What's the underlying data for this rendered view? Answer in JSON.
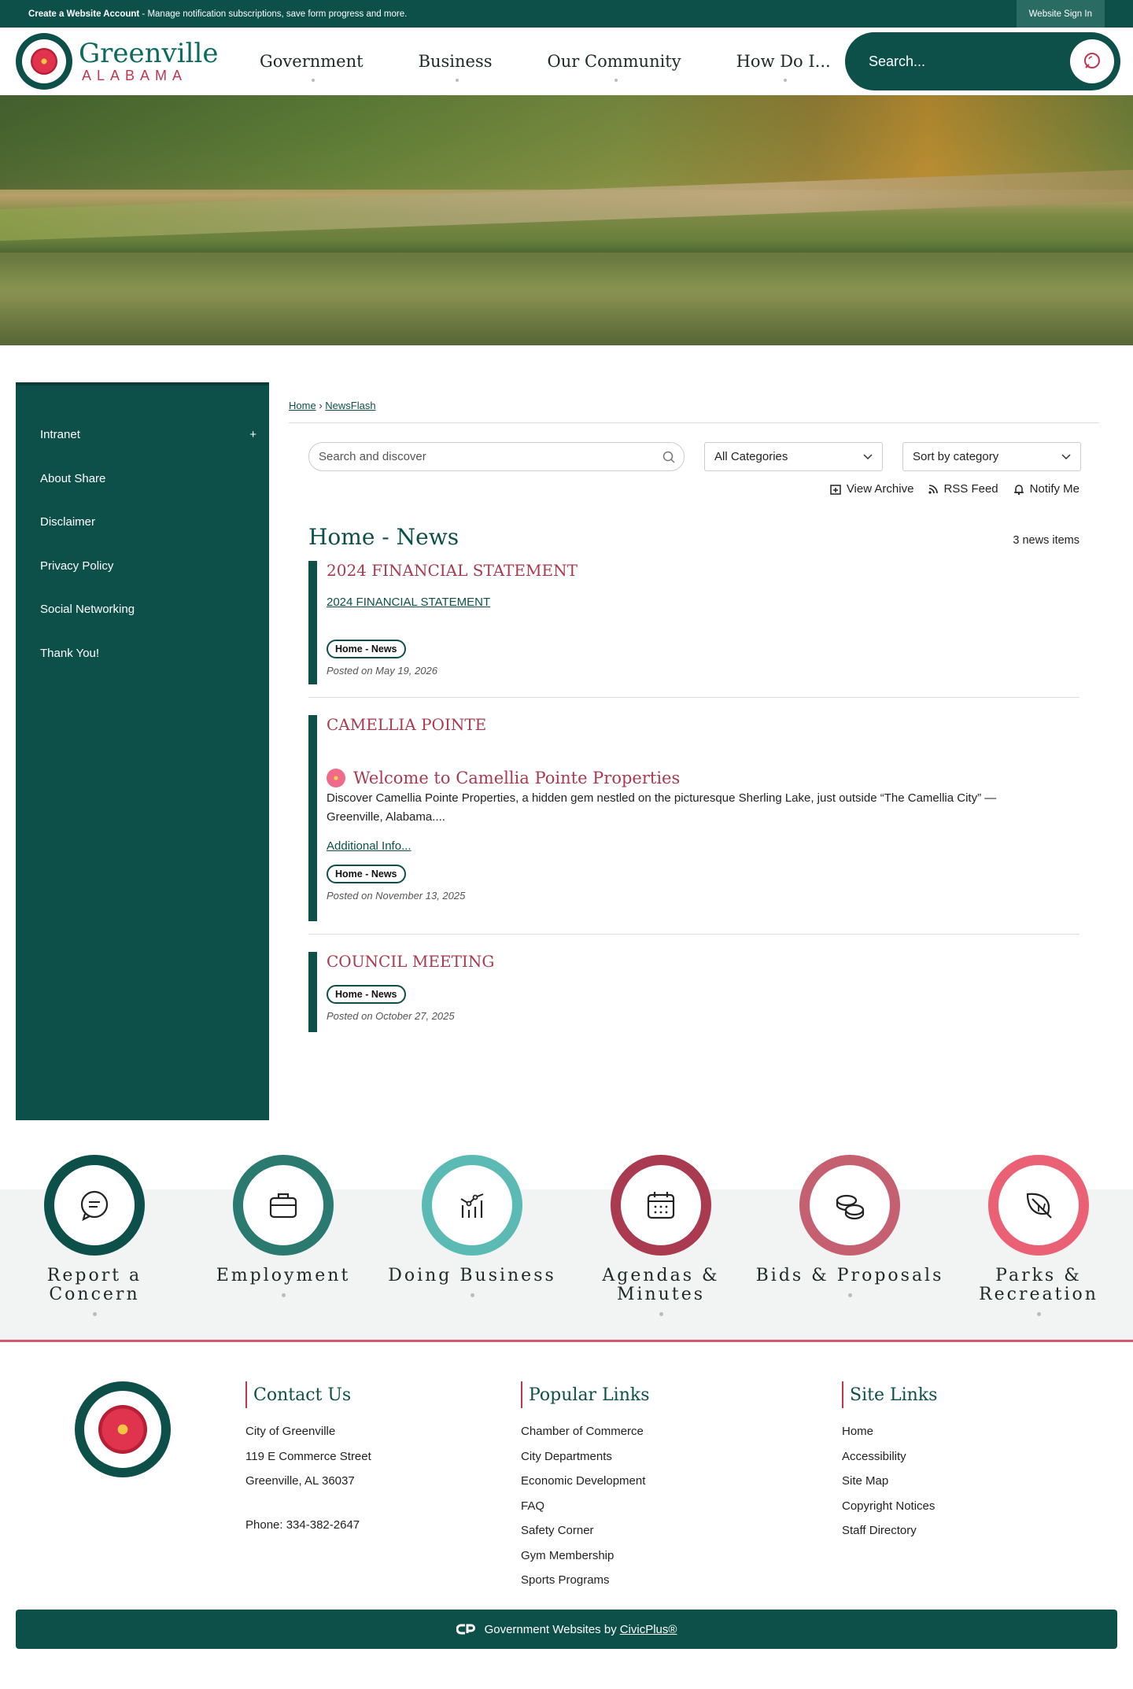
{
  "topbar": {
    "create_account": "Create a Website Account",
    "create_desc": " - Manage notification subscriptions, save form progress and more.",
    "sign_in": "Website Sign In"
  },
  "logo": {
    "name": "Greenville",
    "state": "ALABAMA"
  },
  "nav": [
    "Government",
    "Business",
    "Our Community",
    "How Do I..."
  ],
  "search": {
    "placeholder": "Search..."
  },
  "sidebar": {
    "items": [
      {
        "label": "Intranet",
        "expand": "+"
      },
      {
        "label": "About Share"
      },
      {
        "label": "Disclaimer"
      },
      {
        "label": "Privacy Policy"
      },
      {
        "label": "Social Networking"
      },
      {
        "label": "Thank You!"
      }
    ]
  },
  "breadcrumb": {
    "home": "Home",
    "sep": "›",
    "current": "NewsFlash"
  },
  "filters": {
    "search_placeholder": "Search and discover",
    "category": "All Categories",
    "sort": "Sort by category"
  },
  "actions": {
    "archive": "View Archive",
    "rss": "RSS Feed",
    "notify": "Notify Me"
  },
  "news": {
    "title": "Home - News",
    "count": "3 news items",
    "items": [
      {
        "title": "2024 FINANCIAL STATEMENT",
        "link": "2024 FINANCIAL STATEMENT",
        "tag": "Home - News",
        "posted": "Posted on May 19, 2026"
      },
      {
        "title": "CAMELLIA POINTE",
        "subtitle": "Welcome to Camellia Pointe Properties",
        "desc": "Discover Camellia Pointe Properties, a hidden gem nestled on the picturesque Sherling Lake, just outside “The Camellia City” — Greenville, Alabama....",
        "link": "Additional Info...",
        "tag": "Home - News",
        "posted": "Posted on November 13, 2025"
      },
      {
        "title": "COUNCIL MEETING",
        "tag": "Home - News",
        "posted": "Posted on October 27, 2025"
      }
    ]
  },
  "quick_links": [
    {
      "line1": "Report a",
      "line2": "Concern",
      "color": "#0d5049",
      "icon": "chat-icon"
    },
    {
      "line1": "Employment",
      "line2": "",
      "color": "#2b7a70",
      "icon": "briefcase-icon"
    },
    {
      "line1": "Doing Business",
      "line2": "",
      "color": "#5bbab3",
      "icon": "chart-icon"
    },
    {
      "line1": "Agendas &",
      "line2": "Minutes",
      "color": "#a93a4f",
      "icon": "calendar-icon"
    },
    {
      "line1": "Bids & Proposals",
      "line2": "",
      "color": "#c4606f",
      "icon": "coins-icon"
    },
    {
      "line1": "Parks &",
      "line2": "Recreation",
      "color": "#ea6175",
      "icon": "leaf-icon"
    }
  ],
  "footer": {
    "contact": {
      "title": "Contact Us",
      "lines": [
        "City of Greenville",
        "119 E Commerce Street",
        "Greenville, AL 36037"
      ],
      "phone": "Phone: 334-382-2647"
    },
    "popular": {
      "title": "Popular Links",
      "links": [
        "Chamber of Commerce",
        "City Departments",
        "Economic Development",
        "FAQ",
        "Safety Corner",
        "Gym Membership",
        "Sports Programs"
      ]
    },
    "site": {
      "title": "Site Links",
      "links": [
        "Home",
        "Accessibility",
        "Site Map",
        "Copyright Notices",
        "Staff Directory"
      ]
    }
  },
  "bottom": {
    "text": "Government Websites by",
    "link": "CivicPlus®"
  }
}
